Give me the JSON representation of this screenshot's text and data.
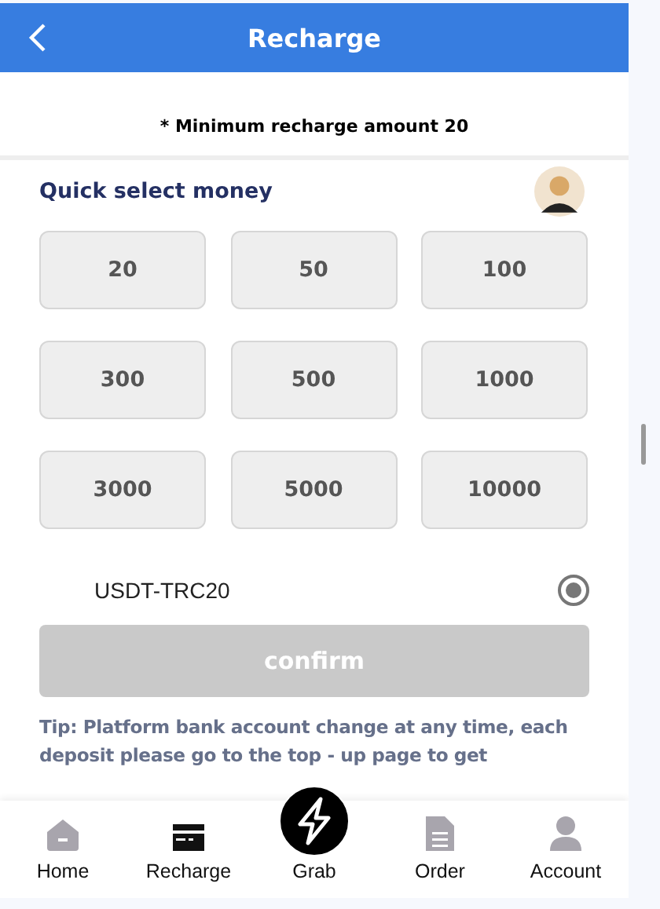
{
  "header": {
    "title": "Recharge"
  },
  "notice": "* Minimum recharge amount 20",
  "quick_select": {
    "title": "Quick select money",
    "amounts": [
      {
        "label": "20",
        "selected": false
      },
      {
        "label": "50",
        "selected": false
      },
      {
        "label": "100",
        "selected": false
      },
      {
        "label": "300",
        "selected": false
      },
      {
        "label": "500",
        "selected": false
      },
      {
        "label": "1000",
        "selected": false
      },
      {
        "label": "3000",
        "selected": false
      },
      {
        "label": "5000",
        "selected": false
      },
      {
        "label": "10000",
        "selected": false
      }
    ]
  },
  "payment_methods": [
    {
      "label": "USDT-TRC20",
      "selected": true
    }
  ],
  "confirm": {
    "label": "confirm",
    "disabled": true
  },
  "tip": "Tip: Platform bank account change at any time, each deposit please go to the top - up page to get",
  "nav": [
    {
      "label": "Home",
      "kind": "home",
      "selected": false
    },
    {
      "label": "Recharge",
      "kind": "card",
      "selected": true
    },
    {
      "label": "Grab",
      "kind": "bolt",
      "selected": false
    },
    {
      "label": "Order",
      "kind": "doc",
      "selected": false
    },
    {
      "label": "Account",
      "kind": "user",
      "selected": false
    }
  ]
}
